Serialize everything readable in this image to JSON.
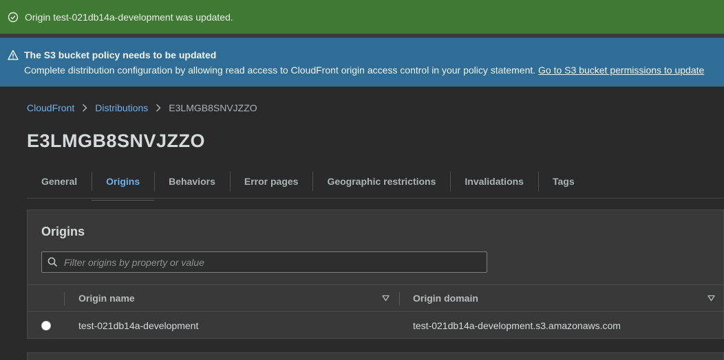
{
  "flash_success": {
    "message": "Origin test-021db14a-development was updated.",
    "icon": "check-circle-icon",
    "color": "#3f7a34"
  },
  "flash_info": {
    "title": "The S3 bucket policy needs to be updated",
    "body": "Complete distribution configuration by allowing read access to CloudFront origin access control in your policy statement.",
    "link": "Go to S3 bucket permissions to update",
    "icon": "warning-icon",
    "color": "#2f6d96"
  },
  "breadcrumb": {
    "items": [
      "CloudFront",
      "Distributions"
    ],
    "current": "E3LMGB8SNVJZZO"
  },
  "page_title": "E3LMGB8SNVJZZO",
  "tabs": [
    {
      "label": "General",
      "active": false
    },
    {
      "label": "Origins",
      "active": true
    },
    {
      "label": "Behaviors",
      "active": false
    },
    {
      "label": "Error pages",
      "active": false
    },
    {
      "label": "Geographic restrictions",
      "active": false
    },
    {
      "label": "Invalidations",
      "active": false
    },
    {
      "label": "Tags",
      "active": false
    }
  ],
  "origins_panel": {
    "title": "Origins",
    "filter_placeholder": "Filter origins by property or value",
    "columns": [
      "Origin name",
      "Origin domain"
    ],
    "rows": [
      {
        "selected": false,
        "name": "test-021db14a-development",
        "domain": "test-021db14a-development.s3.amazonaws.com"
      }
    ]
  },
  "accent_color": "#6fb1e8"
}
